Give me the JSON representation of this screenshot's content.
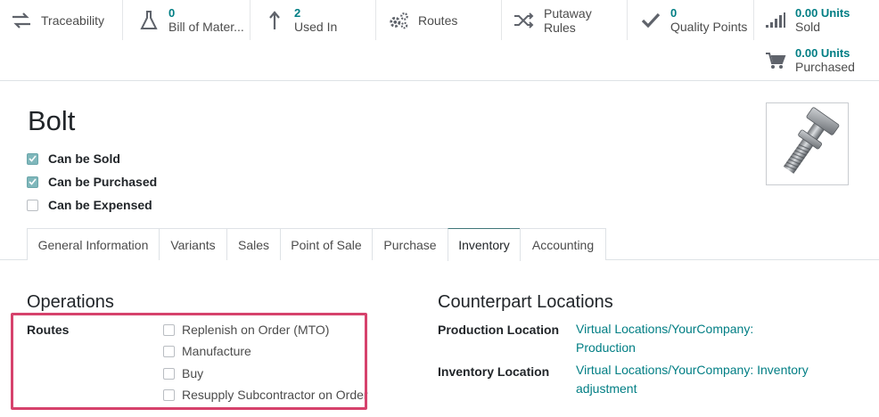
{
  "smart_buttons": {
    "traceability": {
      "label": "Traceability",
      "icon": "arrows-exchange-icon"
    },
    "bom": {
      "value": "0",
      "label": "Bill of Mater...",
      "icon": "flask-icon"
    },
    "used_in": {
      "value": "2",
      "label": "Used In",
      "icon": "level-up-icon"
    },
    "routes": {
      "label": "Routes",
      "icon": "cogs-icon"
    },
    "putaway": {
      "label_line1": "Putaway",
      "label_line2": "Rules",
      "icon": "random-icon"
    },
    "quality": {
      "value": "0",
      "label": "Quality Points",
      "icon": "check-icon"
    },
    "sold": {
      "value": "0.00 Units",
      "label": "Sold",
      "icon": "signal-icon"
    },
    "purchased": {
      "value": "0.00 Units",
      "label": "Purchased",
      "icon": "shopping-cart-icon"
    }
  },
  "product": {
    "name": "Bolt",
    "checkboxes": [
      {
        "label": "Can be Sold",
        "checked": true
      },
      {
        "label": "Can be Purchased",
        "checked": true
      },
      {
        "label": "Can be Expensed",
        "checked": false
      }
    ]
  },
  "tabs": [
    {
      "label": "General Information",
      "active": false
    },
    {
      "label": "Variants",
      "active": false
    },
    {
      "label": "Sales",
      "active": false
    },
    {
      "label": "Point of Sale",
      "active": false
    },
    {
      "label": "Purchase",
      "active": false
    },
    {
      "label": "Inventory",
      "active": true
    },
    {
      "label": "Accounting",
      "active": false
    }
  ],
  "operations": {
    "title": "Operations",
    "routes_label": "Routes",
    "routes": [
      {
        "label": "Replenish on Order (MTO)",
        "checked": false
      },
      {
        "label": "Manufacture",
        "checked": false
      },
      {
        "label": "Buy",
        "checked": false
      },
      {
        "label": "Resupply Subcontractor on Order",
        "checked": false
      }
    ]
  },
  "counterpart": {
    "title": "Counterpart Locations",
    "production_label": "Production Location",
    "production_value_line1": "Virtual Locations/YourCompany:",
    "production_value_line2": "Production",
    "inventory_label": "Inventory Location",
    "inventory_value_line1": "Virtual Locations/YourCompany: Inventory",
    "inventory_value_line2": "adjustment"
  },
  "colors": {
    "accent": "#017e84",
    "highlight": "#d6426c",
    "checkbox_checked": "#7fb7bb"
  }
}
